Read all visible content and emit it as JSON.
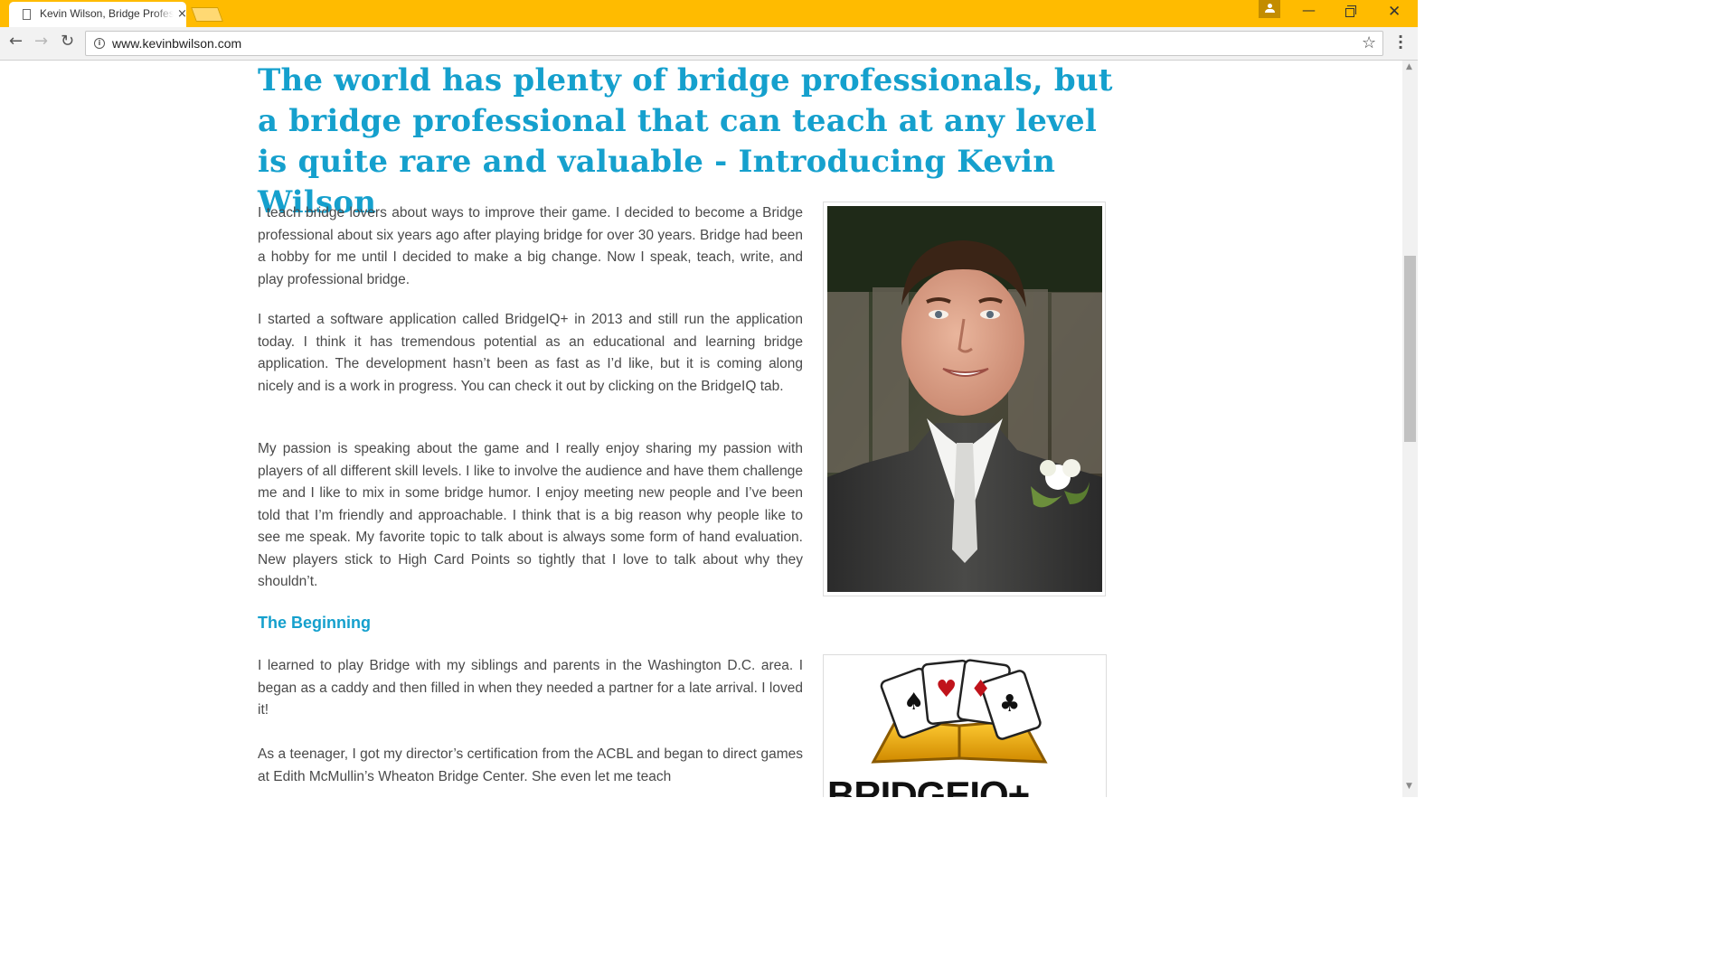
{
  "browser": {
    "tab_title": "Kevin Wilson, Bridge Professional",
    "url": "www.kevinbwilson.com",
    "icons": {
      "close_tab": "×",
      "minimize": "—",
      "close_window": "✕",
      "back": "←",
      "forward": "→",
      "reload": "↻",
      "star": "☆",
      "info": "i"
    }
  },
  "page": {
    "heading": "The world has plenty of bridge professionals, but a bridge professional that can teach at any level is quite rare and valuable - Introducing Kevin Wilson",
    "paragraphs": [
      "I teach bridge lovers about ways to improve their game. I decided to become a Bridge professional about six years ago after playing bridge for over 30 years. Bridge had been a hobby for me until I decided to make a big change. Now I speak, teach, write, and play professional bridge.",
      "I started a software application called BridgeIQ+ in 2013 and still run the application today. I think it has tremendous potential as an educational and learning bridge application. The development hasn’t been as fast as I’d like, but it is coming along nicely and is a work in progress. You can check it out by clicking on the BridgeIQ tab.",
      "My passion is speaking about the game and I really enjoy sharing my passion with players of all different skill levels. I like to involve the audience and have them challenge me and I like to mix in some bridge humor. I enjoy meeting new people and I’ve been told that I’m friendly and approachable. I think that is a big reason why people like to see me speak. My favorite topic to talk about is always some form of hand evaluation. New players stick to High Card Points so tightly that I love to talk about why they shouldn’t."
    ],
    "section_heading": "The Beginning",
    "section_paragraphs": [
      "I learned to play Bridge with my siblings and parents in the Washington D.C. area. I began as a caddy and then filled in when they needed a partner for a late arrival. I loved it!",
      "As a teenager, I got my director’s certification from the ACBL and began to direct games at Edith McMullin’s Wheaton Bridge Center. She even let me teach"
    ],
    "logo_text": "BRIDGEIQ+",
    "colors": {
      "accent": "#15a0cd",
      "chrome": "#ffbb00",
      "body_text": "#4a4a4a"
    }
  }
}
